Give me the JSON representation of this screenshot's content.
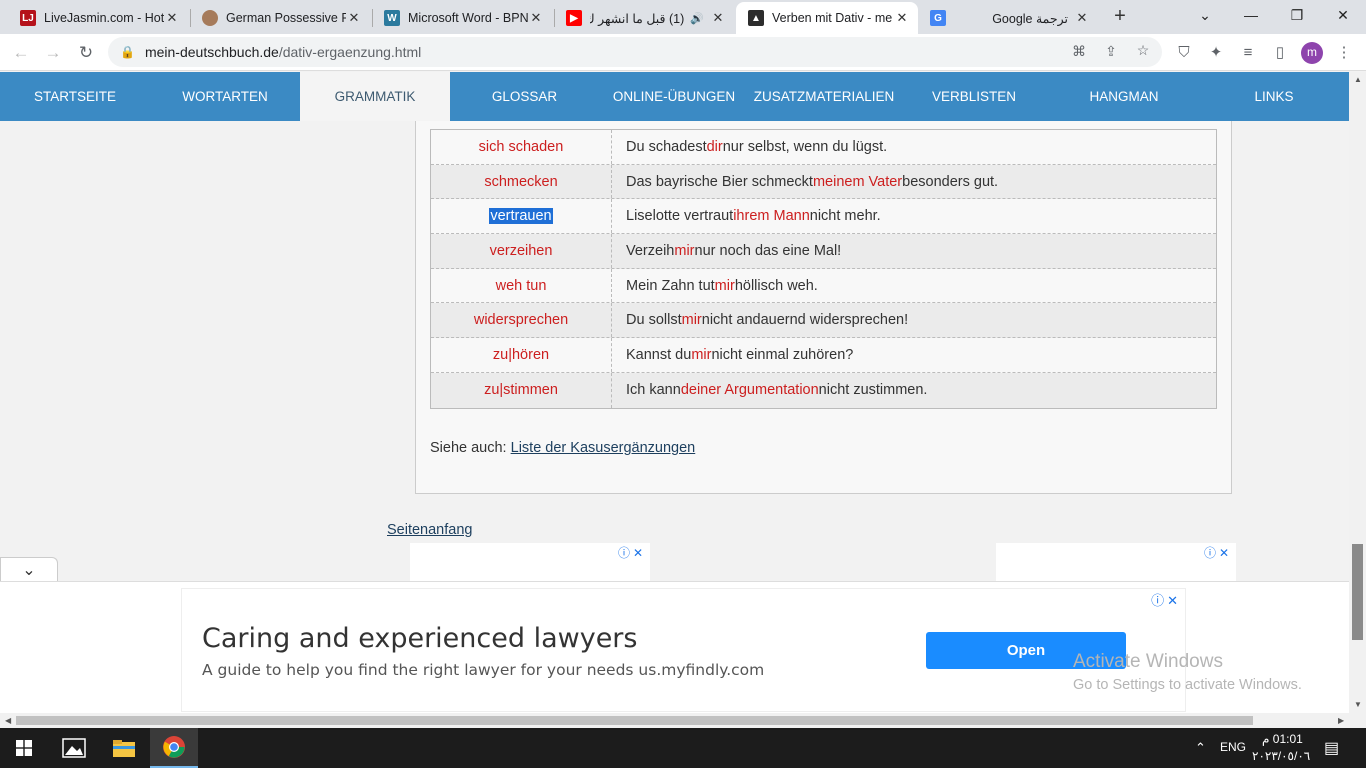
{
  "browser": {
    "tabs": [
      {
        "title": "LiveJasmin.com - Hot",
        "icon": "livejasmin-favicon",
        "active": false
      },
      {
        "title": "German Possessive Pr",
        "icon": "avatar-favicon",
        "active": false
      },
      {
        "title": "Microsoft Word - BPN",
        "icon": "word-favicon",
        "active": false
      },
      {
        "title": "(1) قبل ما انشهر ك",
        "icon": "youtube-favicon",
        "active": false
      },
      {
        "title": "Verben mit Dativ - me",
        "icon": "graduation-cap-favicon",
        "active": true
      },
      {
        "title": "Google ترجمة",
        "icon": "google-translate-favicon",
        "active": false
      }
    ],
    "url_domain": "mein-deutschbuch.de",
    "url_path": "/dativ-ergaenzung.html",
    "avatar_letter": "m"
  },
  "site_nav": {
    "items": [
      {
        "label": "Startseite",
        "active": false
      },
      {
        "label": "Wortarten",
        "active": false
      },
      {
        "label": "Grammatik",
        "active": true
      },
      {
        "label": "Glossar",
        "active": false
      },
      {
        "label": "Online-Übungen",
        "active": false
      },
      {
        "label": "Zusatzmaterialien",
        "active": false
      },
      {
        "label": "Verblisten",
        "active": false
      },
      {
        "label": "Hangman",
        "active": false
      },
      {
        "label": "Links",
        "active": false
      }
    ]
  },
  "verb_table": {
    "rows": [
      {
        "verb": "sich schaden",
        "pre": "Du schadest ",
        "hl": "dir",
        "post": " nur selbst, wenn du lügst.",
        "alt": false
      },
      {
        "verb": "schmecken",
        "pre": "Das bayrische Bier schmeckt ",
        "hl": "meinem Vater",
        "post": " besonders gut.",
        "alt": true
      },
      {
        "verb": "vertrauen",
        "pre": "Liselotte vertraut ",
        "hl": "ihrem Mann",
        "post": " nicht mehr.",
        "alt": false,
        "selected": true
      },
      {
        "verb": "verzeihen",
        "pre": "Verzeih ",
        "hl": "mir",
        "post": " nur noch das eine Mal!",
        "alt": true
      },
      {
        "verb": "weh tun",
        "pre": "Mein Zahn tut ",
        "hl": "mir",
        "post": " höllisch weh.",
        "alt": false
      },
      {
        "verb": "widersprechen",
        "pre": "Du sollst ",
        "hl": "mir",
        "post": " nicht andauernd widersprechen!",
        "alt": true
      },
      {
        "verb": "zu|hören",
        "pre": "Kannst du ",
        "hl": "mir",
        "post": " nicht einmal zuhören?",
        "alt": false
      },
      {
        "verb": "zu|stimmen",
        "pre": "Ich kann ",
        "hl": "deiner Argumentation",
        "post": " nicht zustimmen.",
        "alt": true
      }
    ]
  },
  "see_also": {
    "prefix": "Siehe auch: ",
    "link": "Liste der Kasusergänzungen"
  },
  "top_link": "Seitenanfang",
  "ad": {
    "title": "Caring and experienced lawyers",
    "description": "A guide to help you find the right lawyer for your needs us.myfindly.com",
    "button": "Open"
  },
  "watermark": {
    "line1": "Activate Windows",
    "line2": "Go to Settings to activate Windows."
  },
  "taskbar": {
    "language": "ENG",
    "time": "01:01 م",
    "date": "٢٠٢٣/٠٥/٠٦"
  },
  "colors": {
    "nav_blue": "#3b8ac4",
    "highlight_red": "#cc1f1f",
    "ad_button": "#1a8cff"
  }
}
